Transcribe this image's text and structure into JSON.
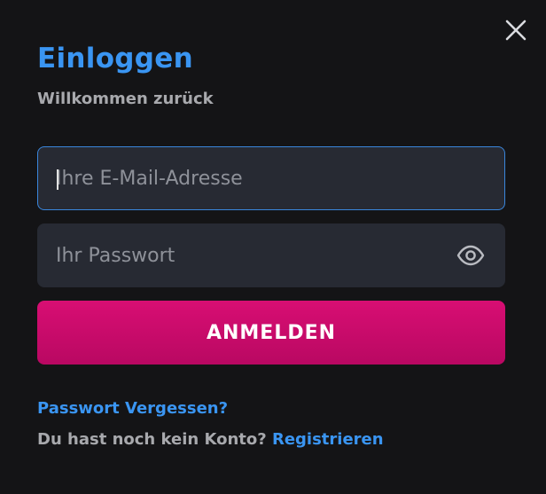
{
  "dialog": {
    "title": "Einloggen",
    "subtitle": "Willkommen zurück",
    "close_icon": "close-icon"
  },
  "form": {
    "email": {
      "placeholder": "Ihre E-Mail-Adresse",
      "value": ""
    },
    "password": {
      "placeholder": "Ihr Passwort",
      "value": "",
      "toggle_icon": "eye-icon"
    },
    "submit_label": "ANMELDEN"
  },
  "links": {
    "forgot_password": "Passwort Vergessen?",
    "no_account_text": "Du hast noch kein Konto?",
    "register": "Registrieren"
  },
  "colors": {
    "background": "#141416",
    "accent_blue": "#3a95f2",
    "field_background": "#272a33",
    "focus_border": "#3a86dc",
    "button_pink": "#d80e73",
    "muted_text": "#a8a9ad"
  }
}
